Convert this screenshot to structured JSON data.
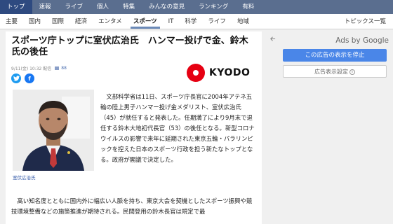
{
  "top_nav": {
    "items": [
      "トップ",
      "速報",
      "ライブ",
      "個人",
      "特集",
      "みんなの意見",
      "ランキング",
      "有料"
    ],
    "active_index": 0
  },
  "sub_nav": {
    "items": [
      "主要",
      "国内",
      "国際",
      "経済",
      "エンタメ",
      "スポーツ",
      "IT",
      "科学",
      "ライフ",
      "地域"
    ],
    "active_index": 5,
    "topics_label": "トピックス一覧"
  },
  "article": {
    "title": "スポーツ庁トップに室伏広治氏　ハンマー投げで金、鈴木氏の後任",
    "date": "9/11(金) 10:32 配信",
    "comment_count": "88",
    "source_logo_text": "KYODO",
    "photo_caption": "室伏広治氏",
    "paragraph1": "文部科学省は11日、スポーツ庁長官に2004年アテネ五輪の陸上男子ハンマー投げ金メダリスト、室伏広治氏（45）が就任すると発表した。任期満了により9月末で退任する鈴木大地初代長官（53）の後任となる。新型コロナウイルスの影響で来年に延期された東京五輪・パラリンピックを控えた日本のスポーツ行政を担う新たなトップとなる。政府が閣議で決定した。",
    "paragraph2": "高い知名度とともに国内外に幅広い人脈を持ち、東京大会を契機としたスポーツ振興や競技環境整備などの施策推進が期待される。民間登用の鈴木長官は規定で最"
  },
  "ads": {
    "back_icon": "back-arrow-icon",
    "by_label": "Ads by Google",
    "stop_label": "この広告の表示を停止",
    "settings_label": "広告表示設定"
  },
  "colors": {
    "top_nav_bg": "#5a6e8f",
    "top_nav_active": "#2e4a80",
    "kyodo_red": "#e60012",
    "ad_button": "#4a86e8"
  }
}
